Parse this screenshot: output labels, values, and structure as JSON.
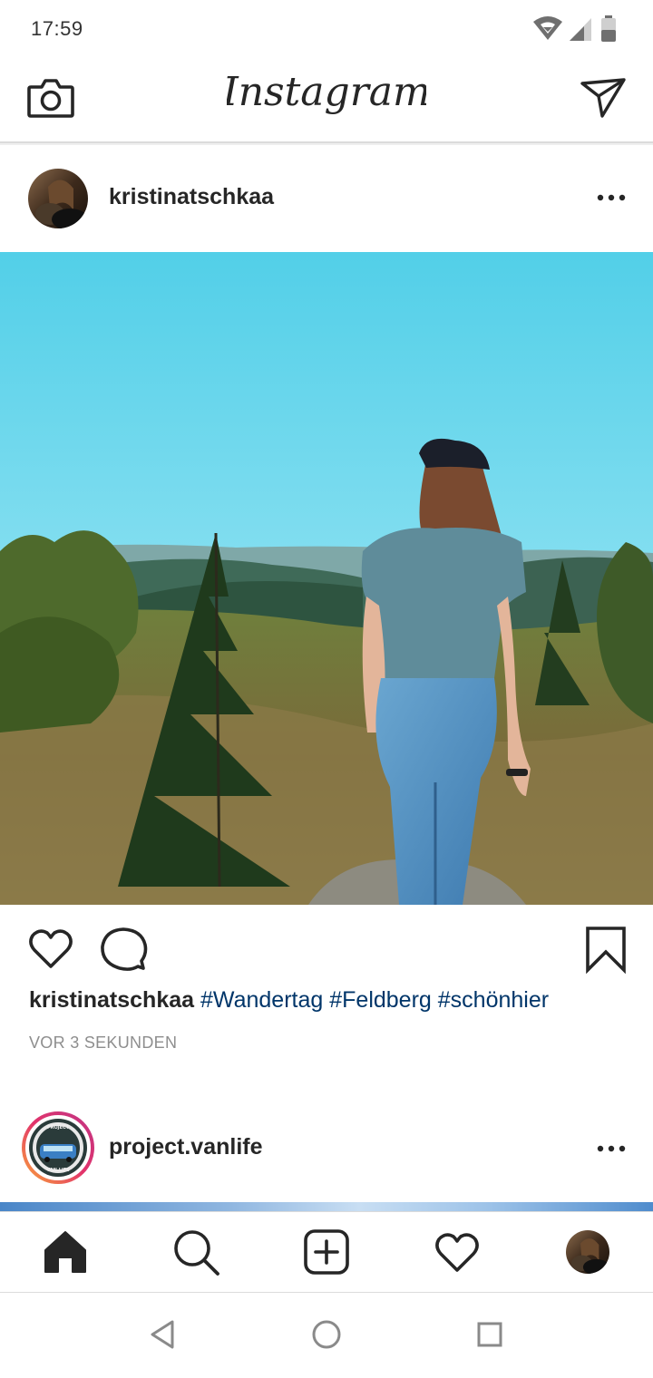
{
  "status_bar": {
    "time": "17:59"
  },
  "header": {
    "logo": "Instagram",
    "camera_icon": "camera-icon",
    "direct_icon": "paper-plane-icon"
  },
  "post1": {
    "username": "kristinatschkaa",
    "caption_user": "kristinatschkaa",
    "hashtags": [
      "#Wandertag",
      "#Feldberg",
      "#schönhier"
    ],
    "timestamp": "VOR 3 SEKUNDEN",
    "actions": [
      "heart-icon",
      "comment-icon",
      "bookmark-icon"
    ]
  },
  "post2": {
    "username": "project.vanlife",
    "avatar_text_top": "PROJECT",
    "avatar_text_bottom": "VAN LIFE"
  },
  "bottom_nav": [
    "home-icon",
    "search-icon",
    "add-post-icon",
    "activity-heart-icon",
    "profile-avatar"
  ],
  "system_nav": [
    "back-icon",
    "home-circle-icon",
    "recents-square-icon"
  ],
  "colors": {
    "hashtag": "#003569",
    "timestamp": "#8e8e8e",
    "divider": "#dbdbdb"
  }
}
